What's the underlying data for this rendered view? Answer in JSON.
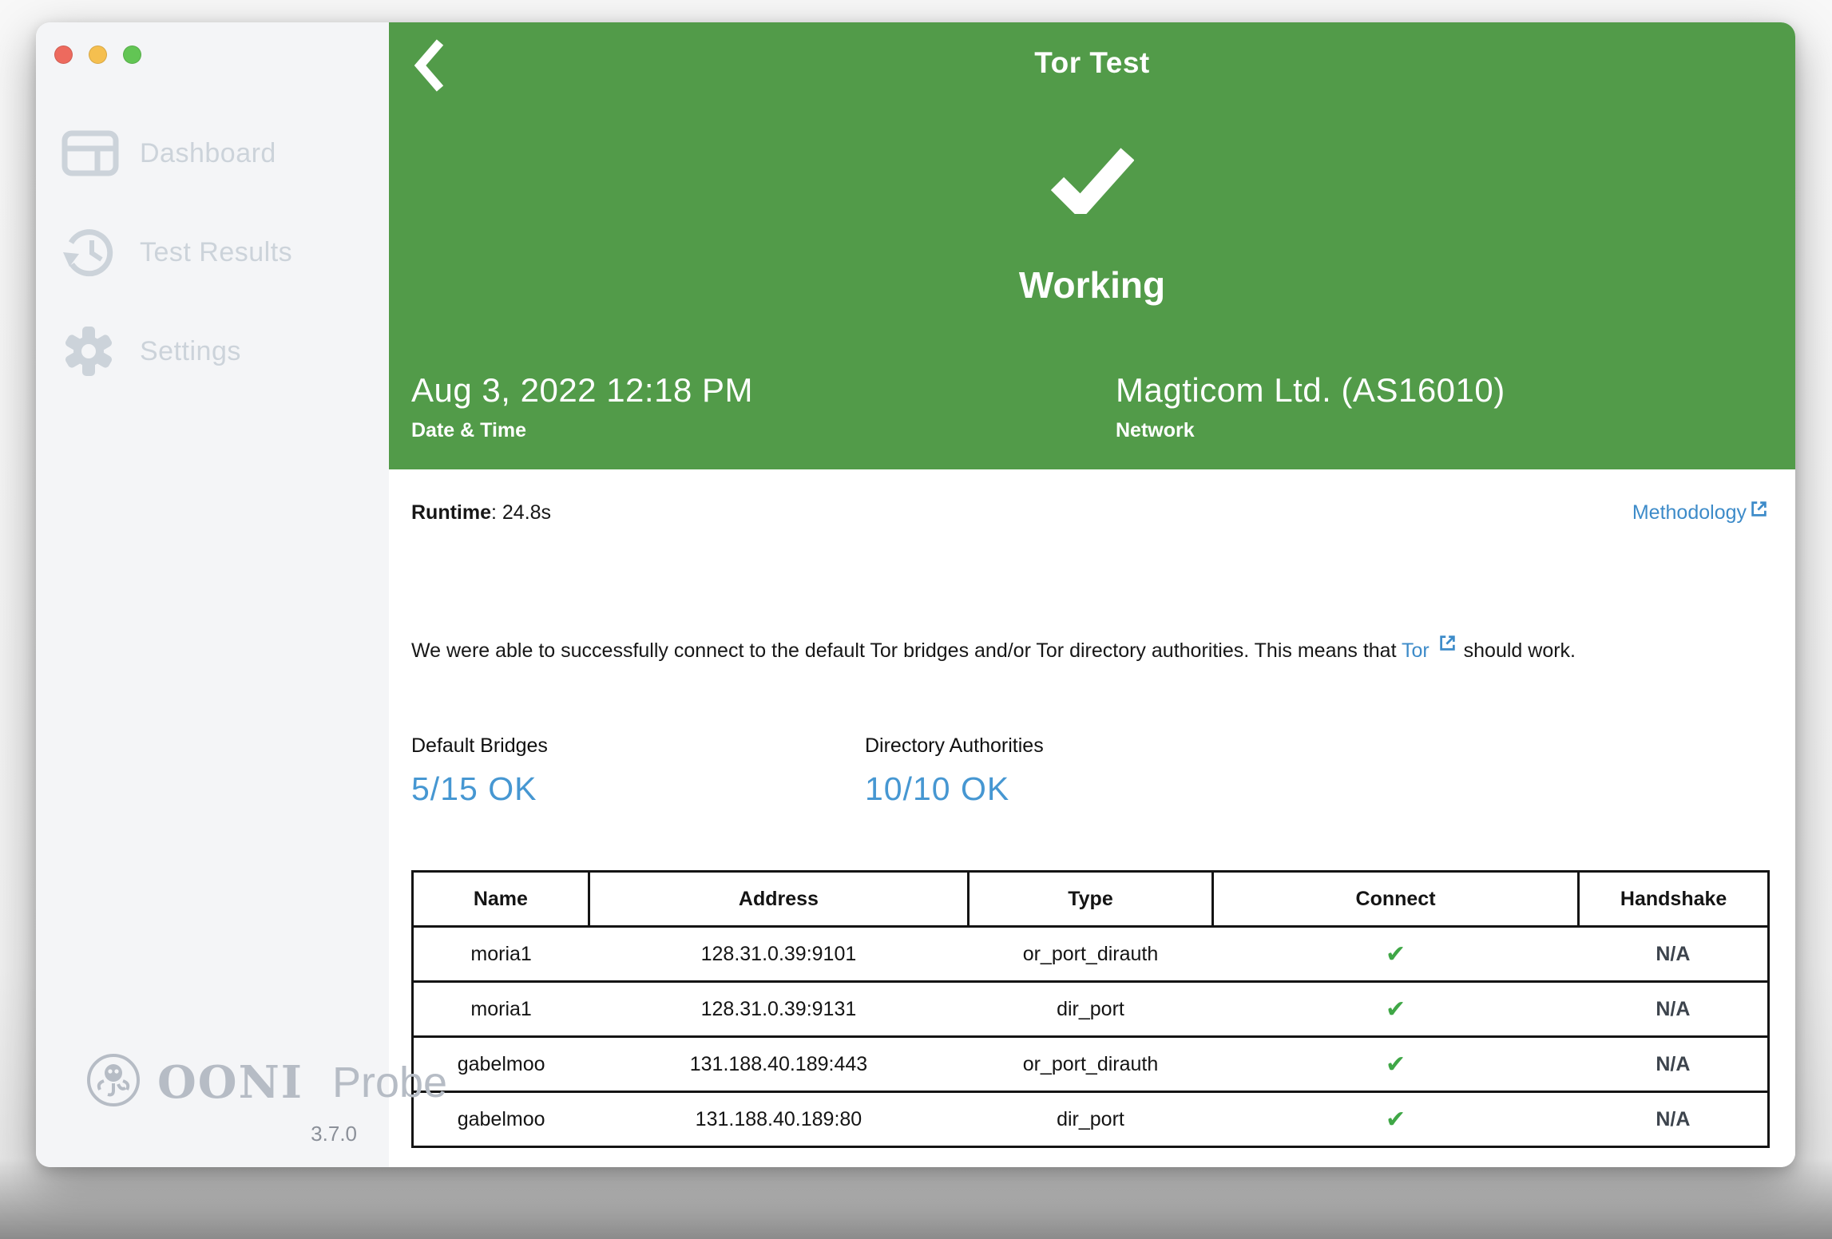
{
  "window": {
    "traffic_lights": {
      "close": "close",
      "minimize": "minimize",
      "zoom": "zoom"
    }
  },
  "sidebar": {
    "items": [
      {
        "label": "Dashboard",
        "icon": "dashboard-icon"
      },
      {
        "label": "Test Results",
        "icon": "history-icon"
      },
      {
        "label": "Settings",
        "icon": "gear-icon"
      }
    ],
    "logo": {
      "brand": "OONI",
      "product": "Probe",
      "version": "3.7.0"
    }
  },
  "header": {
    "title": "Tor Test",
    "status": "Working",
    "bg_color": "#529b49",
    "info": [
      {
        "value": "Aug 3, 2022 12:18 PM",
        "label": "Date & Time"
      },
      {
        "value": "Magticom Ltd. (AS16010)",
        "label": "Network"
      }
    ]
  },
  "summary": {
    "runtime_label": "Runtime",
    "runtime_value": ": 24.8s",
    "methodology_label": "Methodology",
    "description_before": "We were able to successfully connect to the default Tor bridges and/or Tor directory authorities. This means that ",
    "description_link": "Tor",
    "description_after": " should work."
  },
  "stats": [
    {
      "label": "Default Bridges",
      "value": "5/15 OK"
    },
    {
      "label": "Directory Authorities",
      "value": "10/10 OK"
    }
  ],
  "table": {
    "columns": [
      "Name",
      "Address",
      "Type",
      "Connect",
      "Handshake"
    ],
    "rows": [
      {
        "name": "moria1",
        "address": "128.31.0.39:9101",
        "type": "or_port_dirauth",
        "connect": "ok",
        "handshake": "N/A"
      },
      {
        "name": "moria1",
        "address": "128.31.0.39:9131",
        "type": "dir_port",
        "connect": "ok",
        "handshake": "N/A"
      },
      {
        "name": "gabelmoo",
        "address": "131.188.40.189:443",
        "type": "or_port_dirauth",
        "connect": "ok",
        "handshake": "N/A"
      },
      {
        "name": "gabelmoo",
        "address": "131.188.40.189:80",
        "type": "dir_port",
        "connect": "ok",
        "handshake": "N/A"
      }
    ]
  },
  "icons": {
    "check": "✔"
  },
  "colors": {
    "header_green": "#529b49",
    "link_blue": "#3d8bc9",
    "stat_blue": "#4697d2",
    "check_green": "#3fa746",
    "sidebar_muted": "#ccd3da"
  }
}
